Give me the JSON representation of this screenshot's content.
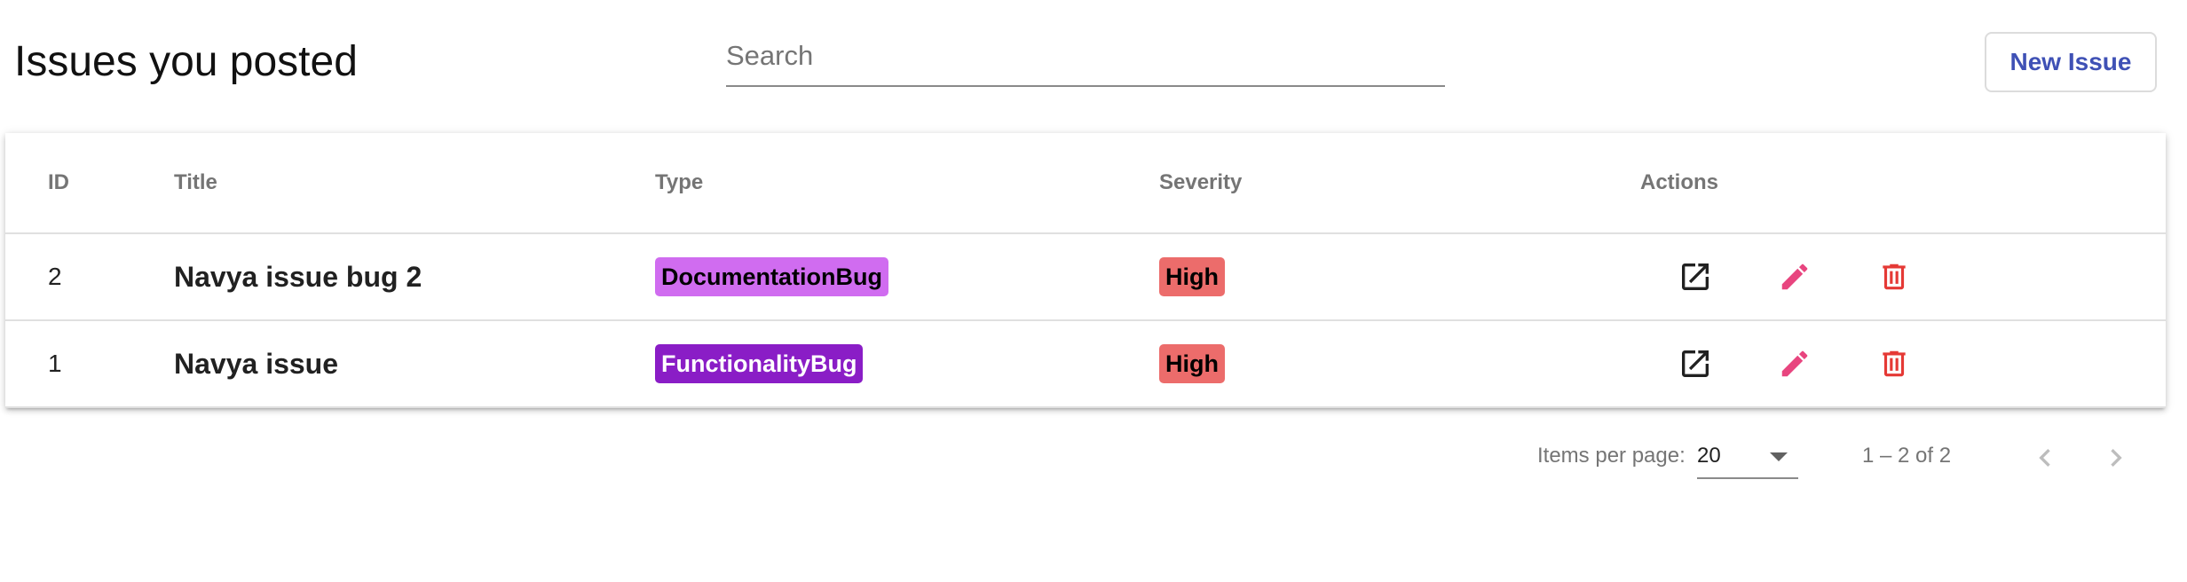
{
  "header": {
    "title": "Issues you posted",
    "search_placeholder": "Search",
    "new_issue_label": "New Issue"
  },
  "table": {
    "columns": [
      "ID",
      "Title",
      "Type",
      "Severity",
      "Actions"
    ],
    "rows": [
      {
        "id": "2",
        "title": "Navya issue bug 2",
        "type": "DocumentationBug",
        "severity": "High"
      },
      {
        "id": "1",
        "title": "Navya issue",
        "type": "FunctionalityBug",
        "severity": "High"
      }
    ],
    "actions": [
      "open-in-new-icon",
      "edit-pencil-icon",
      "delete-trash-icon"
    ]
  },
  "paginator": {
    "items_per_page_label": "Items per page:",
    "page_size": "20",
    "range_label": "1 – 2 of 2"
  },
  "colors": {
    "accent": "#3f51b5",
    "documentation_bug": "#d06cf0",
    "functionality_bug": "#8a1dc6",
    "severity_high": "#ec6c6b",
    "edit_icon": "#e8457f",
    "delete_icon": "#e53935"
  }
}
